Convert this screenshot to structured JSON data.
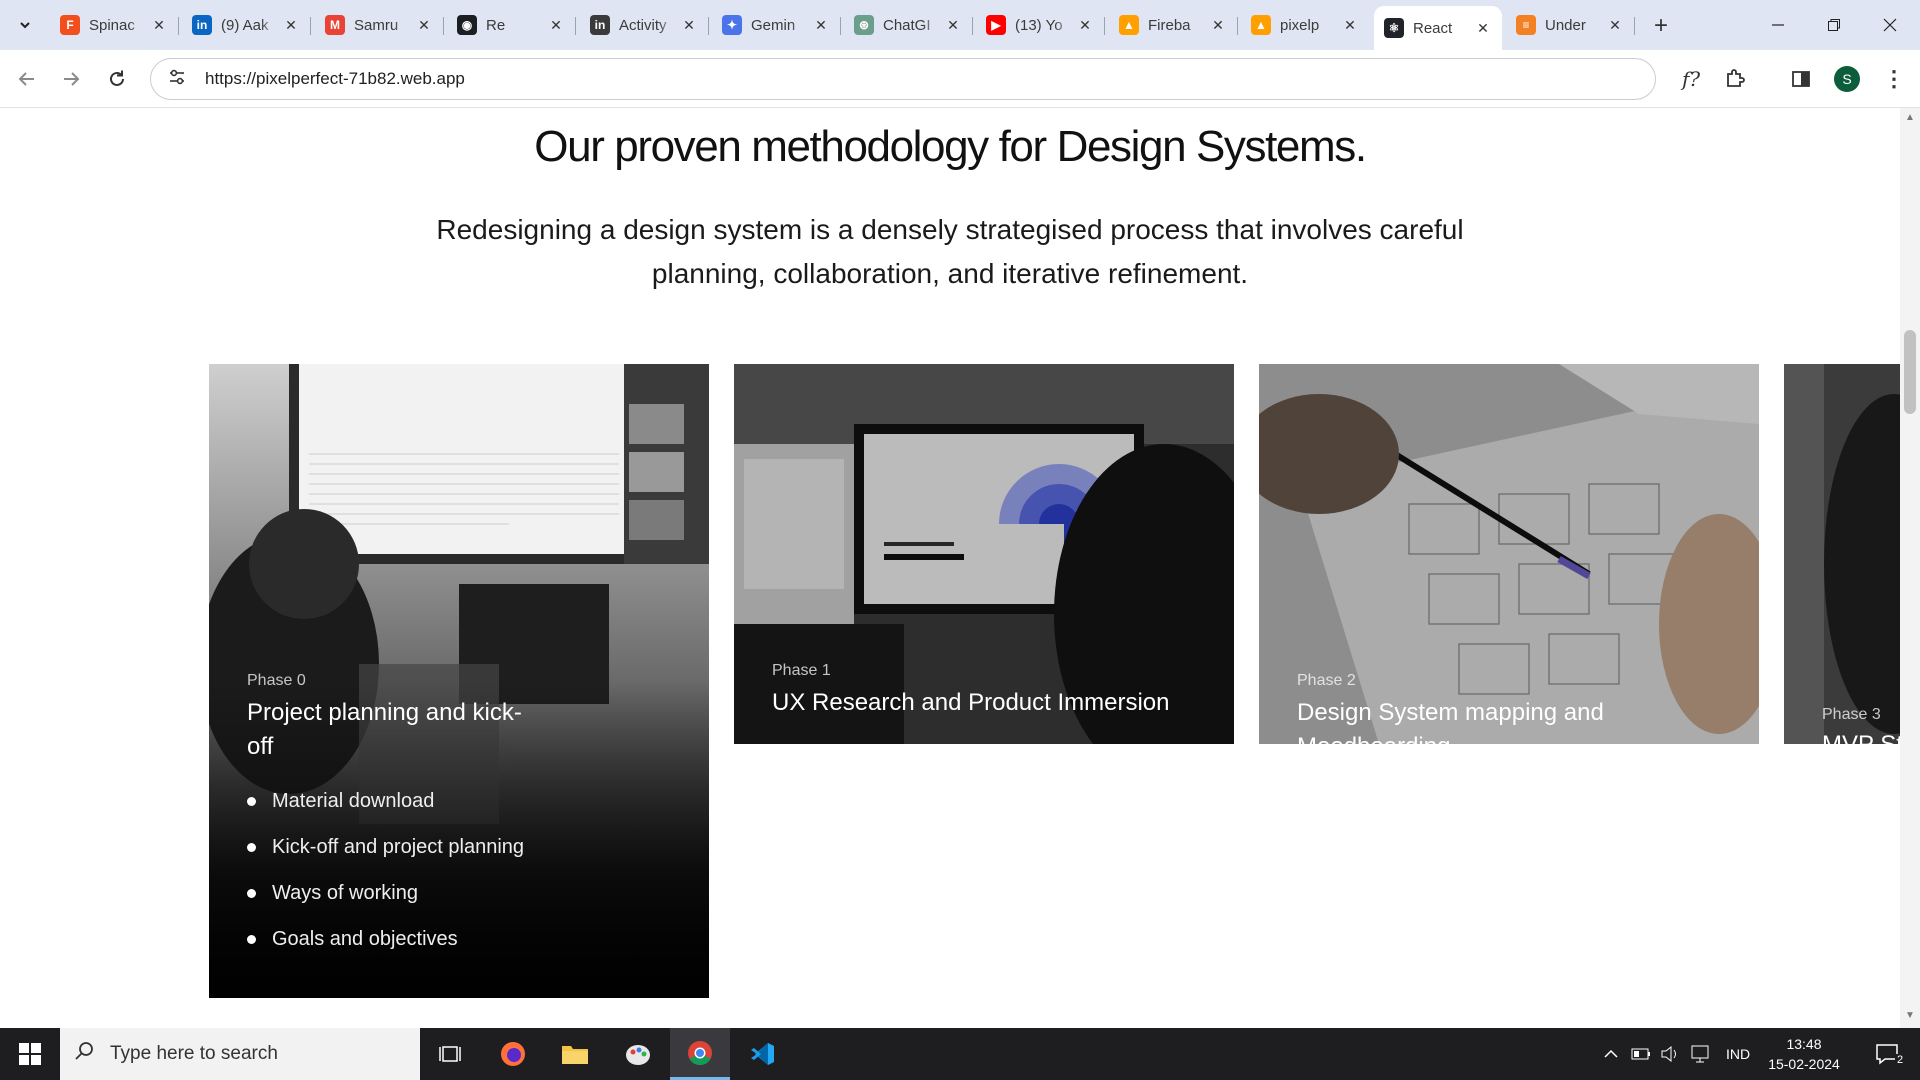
{
  "browser": {
    "tabs": [
      {
        "title": "Spinac",
        "fav": "figma",
        "color": "#f24e1e",
        "glyph": "F"
      },
      {
        "title": "(9) Aak",
        "fav": "linkedin",
        "color": "#0a66c2",
        "glyph": "in"
      },
      {
        "title": "Samru",
        "fav": "gmail",
        "color": "#ea4335",
        "glyph": "M"
      },
      {
        "title": "Re",
        "fav": "github",
        "color": "#1b1f23",
        "glyph": "◉"
      },
      {
        "title": "Activity",
        "fav": "linkedin",
        "color": "#3a3a3a",
        "glyph": "in"
      },
      {
        "title": "Gemin",
        "fav": "gemini",
        "color": "#4b74e8",
        "glyph": "✦"
      },
      {
        "title": "ChatGI",
        "fav": "chatgpt",
        "color": "#6d9e8c",
        "glyph": "⊛"
      },
      {
        "title": "(13) Yo",
        "fav": "youtube",
        "color": "#ff0000",
        "glyph": "▶"
      },
      {
        "title": "Fireba",
        "fav": "firebase",
        "color": "#ffa000",
        "glyph": "▲"
      },
      {
        "title": "pixelp",
        "fav": "firebase",
        "color": "#ffa000",
        "glyph": "▲"
      },
      {
        "title": "React",
        "fav": "react",
        "color": "#20232a",
        "glyph": "⚛"
      },
      {
        "title": "Under",
        "fav": "stack",
        "color": "#f48024",
        "glyph": "≡"
      }
    ],
    "active_tab_index": 10,
    "url": "https://pixelperfect-71b82.web.app",
    "profile_initial": "S"
  },
  "page": {
    "heading": "Our proven methodology for Design Systems.",
    "subtext": "Redesigning a design system is a densely strategised process that involves careful planning, collaboration, and iterative refinement.",
    "cards": [
      {
        "phase": "Phase 0",
        "title": "Project planning and kick-off",
        "bullets": [
          "Material download",
          "Kick-off and project planning",
          "Ways of working",
          "Goals and objectives"
        ]
      },
      {
        "phase": "Phase 1",
        "title": "UX Research and Product Immersion",
        "bullets": []
      },
      {
        "phase": "Phase 2",
        "title": "Design System mapping and Moodboarding",
        "bullets": []
      },
      {
        "phase": "Phase 3",
        "title": "MVP St",
        "bullets": []
      }
    ]
  },
  "taskbar": {
    "search_placeholder": "Type here to search",
    "apps": [
      "task-view",
      "firefox",
      "file-explorer",
      "paint",
      "chrome",
      "vscode"
    ],
    "language": "IND",
    "time": "13:48",
    "date": "15-02-2024",
    "notification_count": "2"
  }
}
